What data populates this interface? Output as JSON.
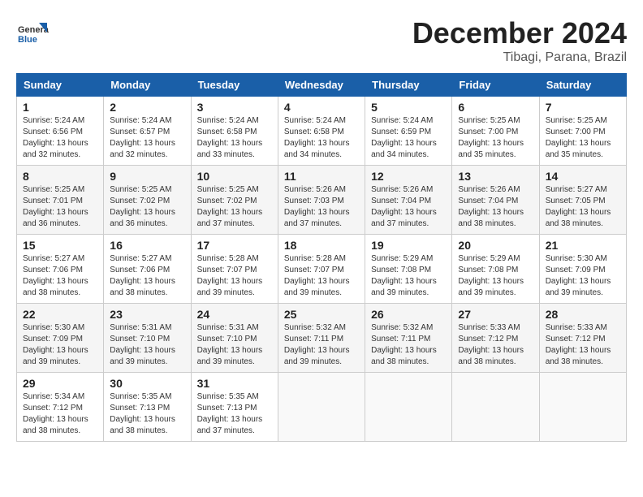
{
  "header": {
    "logo_general": "General",
    "logo_blue": "Blue",
    "month": "December 2024",
    "location": "Tibagi, Parana, Brazil"
  },
  "weekdays": [
    "Sunday",
    "Monday",
    "Tuesday",
    "Wednesday",
    "Thursday",
    "Friday",
    "Saturday"
  ],
  "weeks": [
    [
      {
        "day": "1",
        "info": "Sunrise: 5:24 AM\nSunset: 6:56 PM\nDaylight: 13 hours\nand 32 minutes."
      },
      {
        "day": "2",
        "info": "Sunrise: 5:24 AM\nSunset: 6:57 PM\nDaylight: 13 hours\nand 32 minutes."
      },
      {
        "day": "3",
        "info": "Sunrise: 5:24 AM\nSunset: 6:58 PM\nDaylight: 13 hours\nand 33 minutes."
      },
      {
        "day": "4",
        "info": "Sunrise: 5:24 AM\nSunset: 6:58 PM\nDaylight: 13 hours\nand 34 minutes."
      },
      {
        "day": "5",
        "info": "Sunrise: 5:24 AM\nSunset: 6:59 PM\nDaylight: 13 hours\nand 34 minutes."
      },
      {
        "day": "6",
        "info": "Sunrise: 5:25 AM\nSunset: 7:00 PM\nDaylight: 13 hours\nand 35 minutes."
      },
      {
        "day": "7",
        "info": "Sunrise: 5:25 AM\nSunset: 7:00 PM\nDaylight: 13 hours\nand 35 minutes."
      }
    ],
    [
      {
        "day": "8",
        "info": "Sunrise: 5:25 AM\nSunset: 7:01 PM\nDaylight: 13 hours\nand 36 minutes."
      },
      {
        "day": "9",
        "info": "Sunrise: 5:25 AM\nSunset: 7:02 PM\nDaylight: 13 hours\nand 36 minutes."
      },
      {
        "day": "10",
        "info": "Sunrise: 5:25 AM\nSunset: 7:02 PM\nDaylight: 13 hours\nand 37 minutes."
      },
      {
        "day": "11",
        "info": "Sunrise: 5:26 AM\nSunset: 7:03 PM\nDaylight: 13 hours\nand 37 minutes."
      },
      {
        "day": "12",
        "info": "Sunrise: 5:26 AM\nSunset: 7:04 PM\nDaylight: 13 hours\nand 37 minutes."
      },
      {
        "day": "13",
        "info": "Sunrise: 5:26 AM\nSunset: 7:04 PM\nDaylight: 13 hours\nand 38 minutes."
      },
      {
        "day": "14",
        "info": "Sunrise: 5:27 AM\nSunset: 7:05 PM\nDaylight: 13 hours\nand 38 minutes."
      }
    ],
    [
      {
        "day": "15",
        "info": "Sunrise: 5:27 AM\nSunset: 7:06 PM\nDaylight: 13 hours\nand 38 minutes."
      },
      {
        "day": "16",
        "info": "Sunrise: 5:27 AM\nSunset: 7:06 PM\nDaylight: 13 hours\nand 38 minutes."
      },
      {
        "day": "17",
        "info": "Sunrise: 5:28 AM\nSunset: 7:07 PM\nDaylight: 13 hours\nand 39 minutes."
      },
      {
        "day": "18",
        "info": "Sunrise: 5:28 AM\nSunset: 7:07 PM\nDaylight: 13 hours\nand 39 minutes."
      },
      {
        "day": "19",
        "info": "Sunrise: 5:29 AM\nSunset: 7:08 PM\nDaylight: 13 hours\nand 39 minutes."
      },
      {
        "day": "20",
        "info": "Sunrise: 5:29 AM\nSunset: 7:08 PM\nDaylight: 13 hours\nand 39 minutes."
      },
      {
        "day": "21",
        "info": "Sunrise: 5:30 AM\nSunset: 7:09 PM\nDaylight: 13 hours\nand 39 minutes."
      }
    ],
    [
      {
        "day": "22",
        "info": "Sunrise: 5:30 AM\nSunset: 7:09 PM\nDaylight: 13 hours\nand 39 minutes."
      },
      {
        "day": "23",
        "info": "Sunrise: 5:31 AM\nSunset: 7:10 PM\nDaylight: 13 hours\nand 39 minutes."
      },
      {
        "day": "24",
        "info": "Sunrise: 5:31 AM\nSunset: 7:10 PM\nDaylight: 13 hours\nand 39 minutes."
      },
      {
        "day": "25",
        "info": "Sunrise: 5:32 AM\nSunset: 7:11 PM\nDaylight: 13 hours\nand 39 minutes."
      },
      {
        "day": "26",
        "info": "Sunrise: 5:32 AM\nSunset: 7:11 PM\nDaylight: 13 hours\nand 38 minutes."
      },
      {
        "day": "27",
        "info": "Sunrise: 5:33 AM\nSunset: 7:12 PM\nDaylight: 13 hours\nand 38 minutes."
      },
      {
        "day": "28",
        "info": "Sunrise: 5:33 AM\nSunset: 7:12 PM\nDaylight: 13 hours\nand 38 minutes."
      }
    ],
    [
      {
        "day": "29",
        "info": "Sunrise: 5:34 AM\nSunset: 7:12 PM\nDaylight: 13 hours\nand 38 minutes."
      },
      {
        "day": "30",
        "info": "Sunrise: 5:35 AM\nSunset: 7:13 PM\nDaylight: 13 hours\nand 38 minutes."
      },
      {
        "day": "31",
        "info": "Sunrise: 5:35 AM\nSunset: 7:13 PM\nDaylight: 13 hours\nand 37 minutes."
      },
      null,
      null,
      null,
      null
    ]
  ]
}
